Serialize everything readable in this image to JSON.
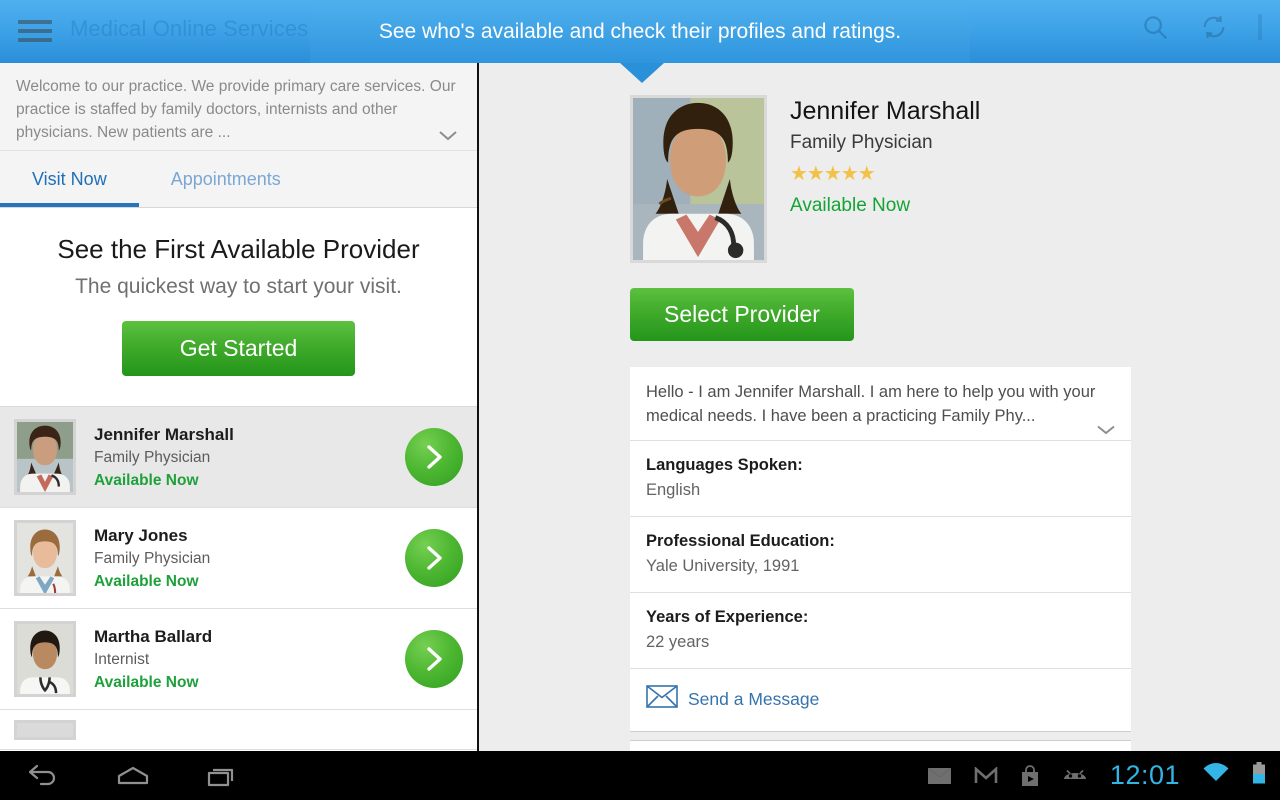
{
  "appbar": {
    "title": "Medical Online Services",
    "menu_icon": "hamburger-menu-icon",
    "search_icon": "search-icon",
    "refresh_icon": "refresh-icon",
    "overflow_icon": "overflow-menu-icon"
  },
  "coachmark": {
    "message": "See who's available and check their profiles and ratings."
  },
  "left": {
    "welcome_text": "Welcome to our practice. We provide primary care services. Our practice is staffed by family doctors, internists and other physicians. New patients are ...",
    "expand_icon": "chevron-down-icon",
    "tabs": [
      {
        "label": "Visit Now",
        "active": true
      },
      {
        "label": "Appointments",
        "active": false
      }
    ],
    "hero": {
      "title": "See the First Available Provider",
      "subtitle": "The quickest way to start your visit.",
      "button_label": "Get Started"
    },
    "providers": [
      {
        "name": "Jennifer Marshall",
        "specialty": "Family Physician",
        "status": "Available Now",
        "selected": true
      },
      {
        "name": "Mary Jones",
        "specialty": "Family Physician",
        "status": "Available Now",
        "selected": false
      },
      {
        "name": "Martha Ballard",
        "specialty": "Internist",
        "status": "Available Now",
        "selected": false
      }
    ]
  },
  "detail": {
    "name": "Jennifer Marshall",
    "specialty": "Family Physician",
    "rating_stars": "★★★★★",
    "rating_value": 5,
    "status": "Available Now",
    "select_button_label": "Select Provider",
    "bio": "Hello - I am Jennifer Marshall. I am here to help you with your medical needs. I have been a practicing Family Phy...",
    "bio_expand_icon": "chevron-down-icon",
    "fields": [
      {
        "label": "Languages Spoken:",
        "value": "English"
      },
      {
        "label": "Professional Education:",
        "value": "Yale University, 1991"
      },
      {
        "label": "Years of Experience:",
        "value": "22 years"
      }
    ],
    "message_link": "Send a Message",
    "message_icon": "envelope-icon"
  },
  "system": {
    "back_icon": "back-arrow-icon",
    "home_icon": "home-icon",
    "recents_icon": "recent-apps-icon",
    "tray_icons": [
      "email-icon",
      "gmail-icon",
      "play-store-icon",
      "android-icon"
    ],
    "clock": "12:01",
    "wifi_icon": "wifi-icon",
    "battery_icon": "battery-icon"
  },
  "colors": {
    "accent_blue": "#2a8fd8",
    "action_green": "#3fa92b",
    "status_green": "#1ea03a",
    "star_gold": "#f2c248",
    "link_blue": "#3573ad",
    "clock_blue": "#33b5e5"
  }
}
